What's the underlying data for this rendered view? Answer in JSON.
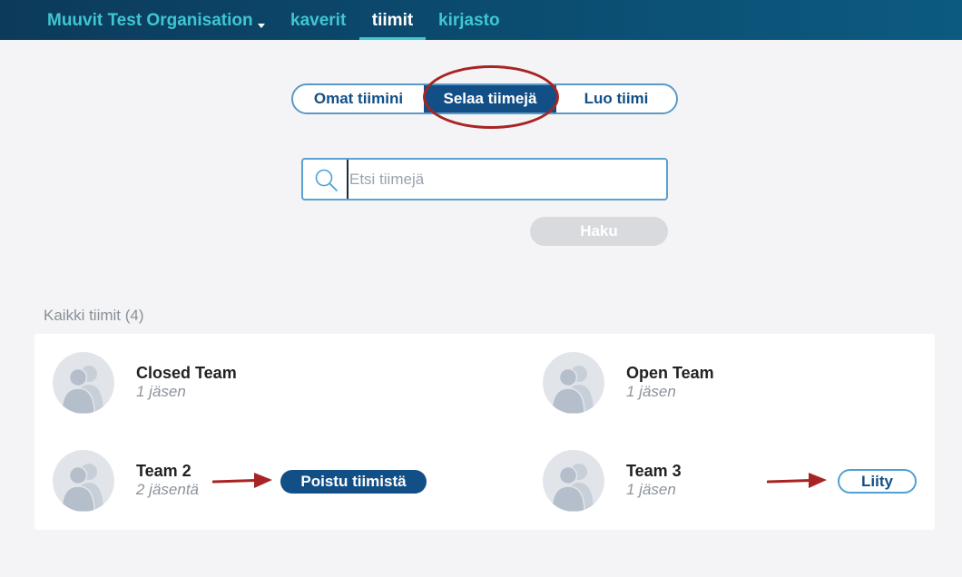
{
  "nav": {
    "organisation": "Muuvit Test Organisation",
    "items": [
      {
        "label": "kaverit"
      },
      {
        "label": "tiimit"
      },
      {
        "label": "kirjasto"
      }
    ]
  },
  "segments": [
    {
      "label": "Omat tiimini",
      "active": false
    },
    {
      "label": "Selaa tiimejä",
      "active": true
    },
    {
      "label": "Luo tiimi",
      "active": false
    }
  ],
  "search": {
    "placeholder": "Etsi tiimejä",
    "value": "",
    "button_label": "Haku"
  },
  "section_title": "Kaikki tiimit (4)",
  "teams": [
    {
      "name": "Closed Team",
      "members": "1 jäsen"
    },
    {
      "name": "Open Team",
      "members": "1 jäsen"
    },
    {
      "name": "Team 2",
      "members": "2 jäsentä",
      "action": "Poistu tiimistä"
    },
    {
      "name": "Team 3",
      "members": "1 jäsen",
      "action": "Liity"
    }
  ],
  "colors": {
    "primary": "#124f86",
    "accent": "#3fc6d3",
    "annotation": "#a82424",
    "background": "#f4f4f6"
  },
  "icons": {
    "search": "magnifier-icon",
    "avatar": "team-avatar-icon",
    "caret": "caret-down-icon"
  }
}
